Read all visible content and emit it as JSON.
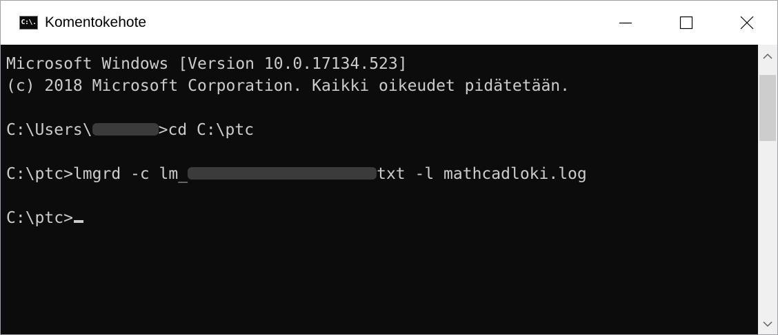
{
  "window": {
    "title": "Komentokehote",
    "icon_text": "C:\\.",
    "icon_name": "cmd-app-icon",
    "controls": [
      "minimize",
      "maximize",
      "close"
    ]
  },
  "console": {
    "line1": "Microsoft Windows [Version 10.0.17134.523]",
    "line2": "(c) 2018 Microsoft Corporation. Kaikki oikeudet pidätetään.",
    "line3_prefix": "C:\\Users\\",
    "line3_suffix": ">cd C:\\ptc",
    "line4_prefix": "C:\\ptc>lmgrd -c lm_",
    "line4_suffix": "txt -l mathcadloki.log",
    "line5_prompt": "C:\\ptc>"
  },
  "colors": {
    "console_bg": "#0c0c0c",
    "console_text": "#cccccc",
    "titlebar_bg": "#ffffff",
    "scrollbar_bg": "#f0f0f0"
  }
}
